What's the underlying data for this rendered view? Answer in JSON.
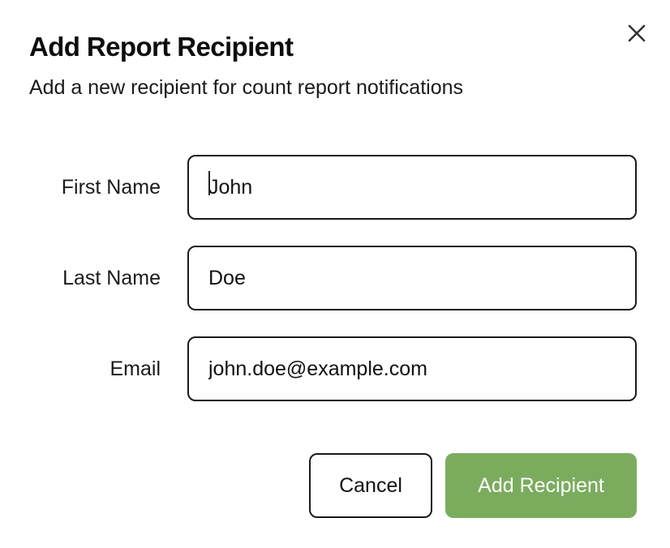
{
  "dialog": {
    "title": "Add Report Recipient",
    "subtitle": "Add a new recipient for count report notifications",
    "close_icon": "close-icon"
  },
  "form": {
    "first_name": {
      "label": "First Name",
      "value": "John"
    },
    "last_name": {
      "label": "Last Name",
      "value": "Doe"
    },
    "email": {
      "label": "Email",
      "value": "john.doe@example.com"
    }
  },
  "actions": {
    "cancel_label": "Cancel",
    "submit_label": "Add Recipient"
  },
  "colors": {
    "primary": "#7bac5e",
    "border": "#1a1a1a",
    "text": "#111111"
  }
}
